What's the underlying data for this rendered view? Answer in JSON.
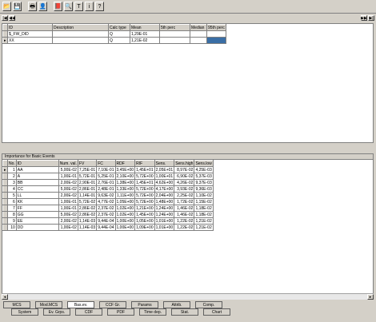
{
  "toolbar": {
    "buttons": [
      {
        "name": "open-icon",
        "glyph": "📂"
      },
      {
        "name": "save-icon",
        "glyph": "💾"
      },
      {
        "name": "print-icon",
        "glyph": "🖶"
      },
      {
        "name": "user-icon",
        "glyph": "👤"
      },
      {
        "name": "book-icon",
        "glyph": "📕"
      },
      {
        "name": "grid-search-icon",
        "glyph": "🔍"
      },
      {
        "name": "text-tool-icon",
        "glyph": "T"
      },
      {
        "name": "info-icon",
        "glyph": "i"
      },
      {
        "name": "help-icon",
        "glyph": "?"
      }
    ]
  },
  "navigator": {
    "first": "|◀",
    "prev": "◀◀",
    "next": "▶▶",
    "last": "▶|"
  },
  "top_grid": {
    "columns": [
      "ID",
      "Description",
      "Calc type",
      "Mean",
      "5th perc",
      "Median",
      "95th perc"
    ],
    "rows": [
      {
        "id": "$_FW_DID",
        "desc": "",
        "calc": "Q",
        "mean": "1,29E-01",
        "p5": "",
        "median": "",
        "p95": ""
      },
      {
        "id": "XX",
        "desc": "",
        "calc": "Q",
        "mean": "1,21E-02",
        "p5": "",
        "median": "",
        "p95": ""
      }
    ]
  },
  "bottom": {
    "title": "Importance for Basic Events",
    "columns": [
      "No.",
      "ID",
      "Num. val.",
      "FV",
      "FC",
      "RDF",
      "RIF",
      "Sens.",
      "Sens.high",
      "Sens.low"
    ],
    "rows": [
      {
        "no": "1",
        "id": "AA",
        "num": "5,00E-02",
        "fv": "7,25E-01",
        "fc": "7,10E-01",
        "rdf": "3,45E+00",
        "rif": "1,45E+01",
        "sens": "2,05E+01",
        "shigh": "8,97E-02",
        "slow": "4,25E-03"
      },
      {
        "no": "2",
        "id": "A",
        "num": "1,00E-01",
        "fv": "5,72E-01",
        "fc": "5,25E-01",
        "rdf": "2,10E+00",
        "rif": "5,72E+00",
        "sens": "1,00E+01",
        "shigh": "6,90E-02",
        "slow": "5,37E-03"
      },
      {
        "no": "3",
        "id": "BB",
        "num": "2,00E-02",
        "fv": "2,90E-01",
        "fc": "2,76E-01",
        "rdf": "1,38E+00",
        "rif": "1,45E+01",
        "sens": "4,62E+00",
        "shigh": "4,26E-02",
        "slow": "9,37E-03"
      },
      {
        "no": "4",
        "id": "CC",
        "num": "5,00E-02",
        "fv": "2,86E-01",
        "fc": "2,48E-01",
        "rdf": "1,33E+00",
        "rif": "5,72E+00",
        "sens": "4,17E+00",
        "shigh": "3,93E-02",
        "slow": "9,36E-03"
      },
      {
        "no": "5",
        "id": "LL",
        "num": "2,00E-02",
        "fv": "1,14E-01",
        "fc": "9,63E-02",
        "rdf": "1,11E+00",
        "rif": "5,72E+00",
        "sens": "2,04E+00",
        "shigh": "2,25E-02",
        "slow": "1,10E-02"
      },
      {
        "no": "6",
        "id": "KK",
        "num": "1,00E-01",
        "fv": "5,72E-02",
        "fc": "4,77E-02",
        "rdf": "1,05E+00",
        "rif": "5,72E+00",
        "sens": "1,48E+00",
        "shigh": "1,72E-02",
        "slow": "1,15E-02"
      },
      {
        "no": "7",
        "id": "FF",
        "num": "1,00E-01",
        "fv": "2,86E-02",
        "fc": "2,37E-02",
        "rdf": "1,02E+00",
        "rif": "1,21E+00",
        "sens": "1,24E+00",
        "shigh": "1,46E-02",
        "slow": "1,18E-02"
      },
      {
        "no": "8",
        "id": "GG",
        "num": "5,00E-02",
        "fv": "2,86E-02",
        "fc": "2,37E-02",
        "rdf": "1,02E+00",
        "rif": "1,45E+00",
        "sens": "1,24E+00",
        "shigh": "1,46E-02",
        "slow": "1,18E-02"
      },
      {
        "no": "9",
        "id": "EE",
        "num": "2,00E-02",
        "fv": "1,14E-03",
        "fc": "9,44E-04",
        "rdf": "1,00E+00",
        "rif": "1,05E+00",
        "sens": "1,01E+00",
        "shigh": "1,22E-02",
        "slow": "1,21E-02"
      },
      {
        "no": "10",
        "id": "DD",
        "num": "1,00E-02",
        "fv": "1,14E-03",
        "fc": "9,44E-04",
        "rdf": "1,00E+00",
        "rif": "1,09E+00",
        "sens": "1,01E+00",
        "shigh": "1,22E-02",
        "slow": "1,21E-02"
      }
    ]
  },
  "tabs": {
    "top": [
      "MCS",
      "Mod.MCS",
      "Bas.ev.",
      "CCF Gr.",
      "Params",
      "Attrib.",
      "Comp."
    ],
    "bottom": [
      "System",
      "Ev. Grps.",
      "CDF",
      "PDF",
      "Time dep.",
      "Stat.",
      "Chart"
    ],
    "active": "Bas.ev."
  }
}
